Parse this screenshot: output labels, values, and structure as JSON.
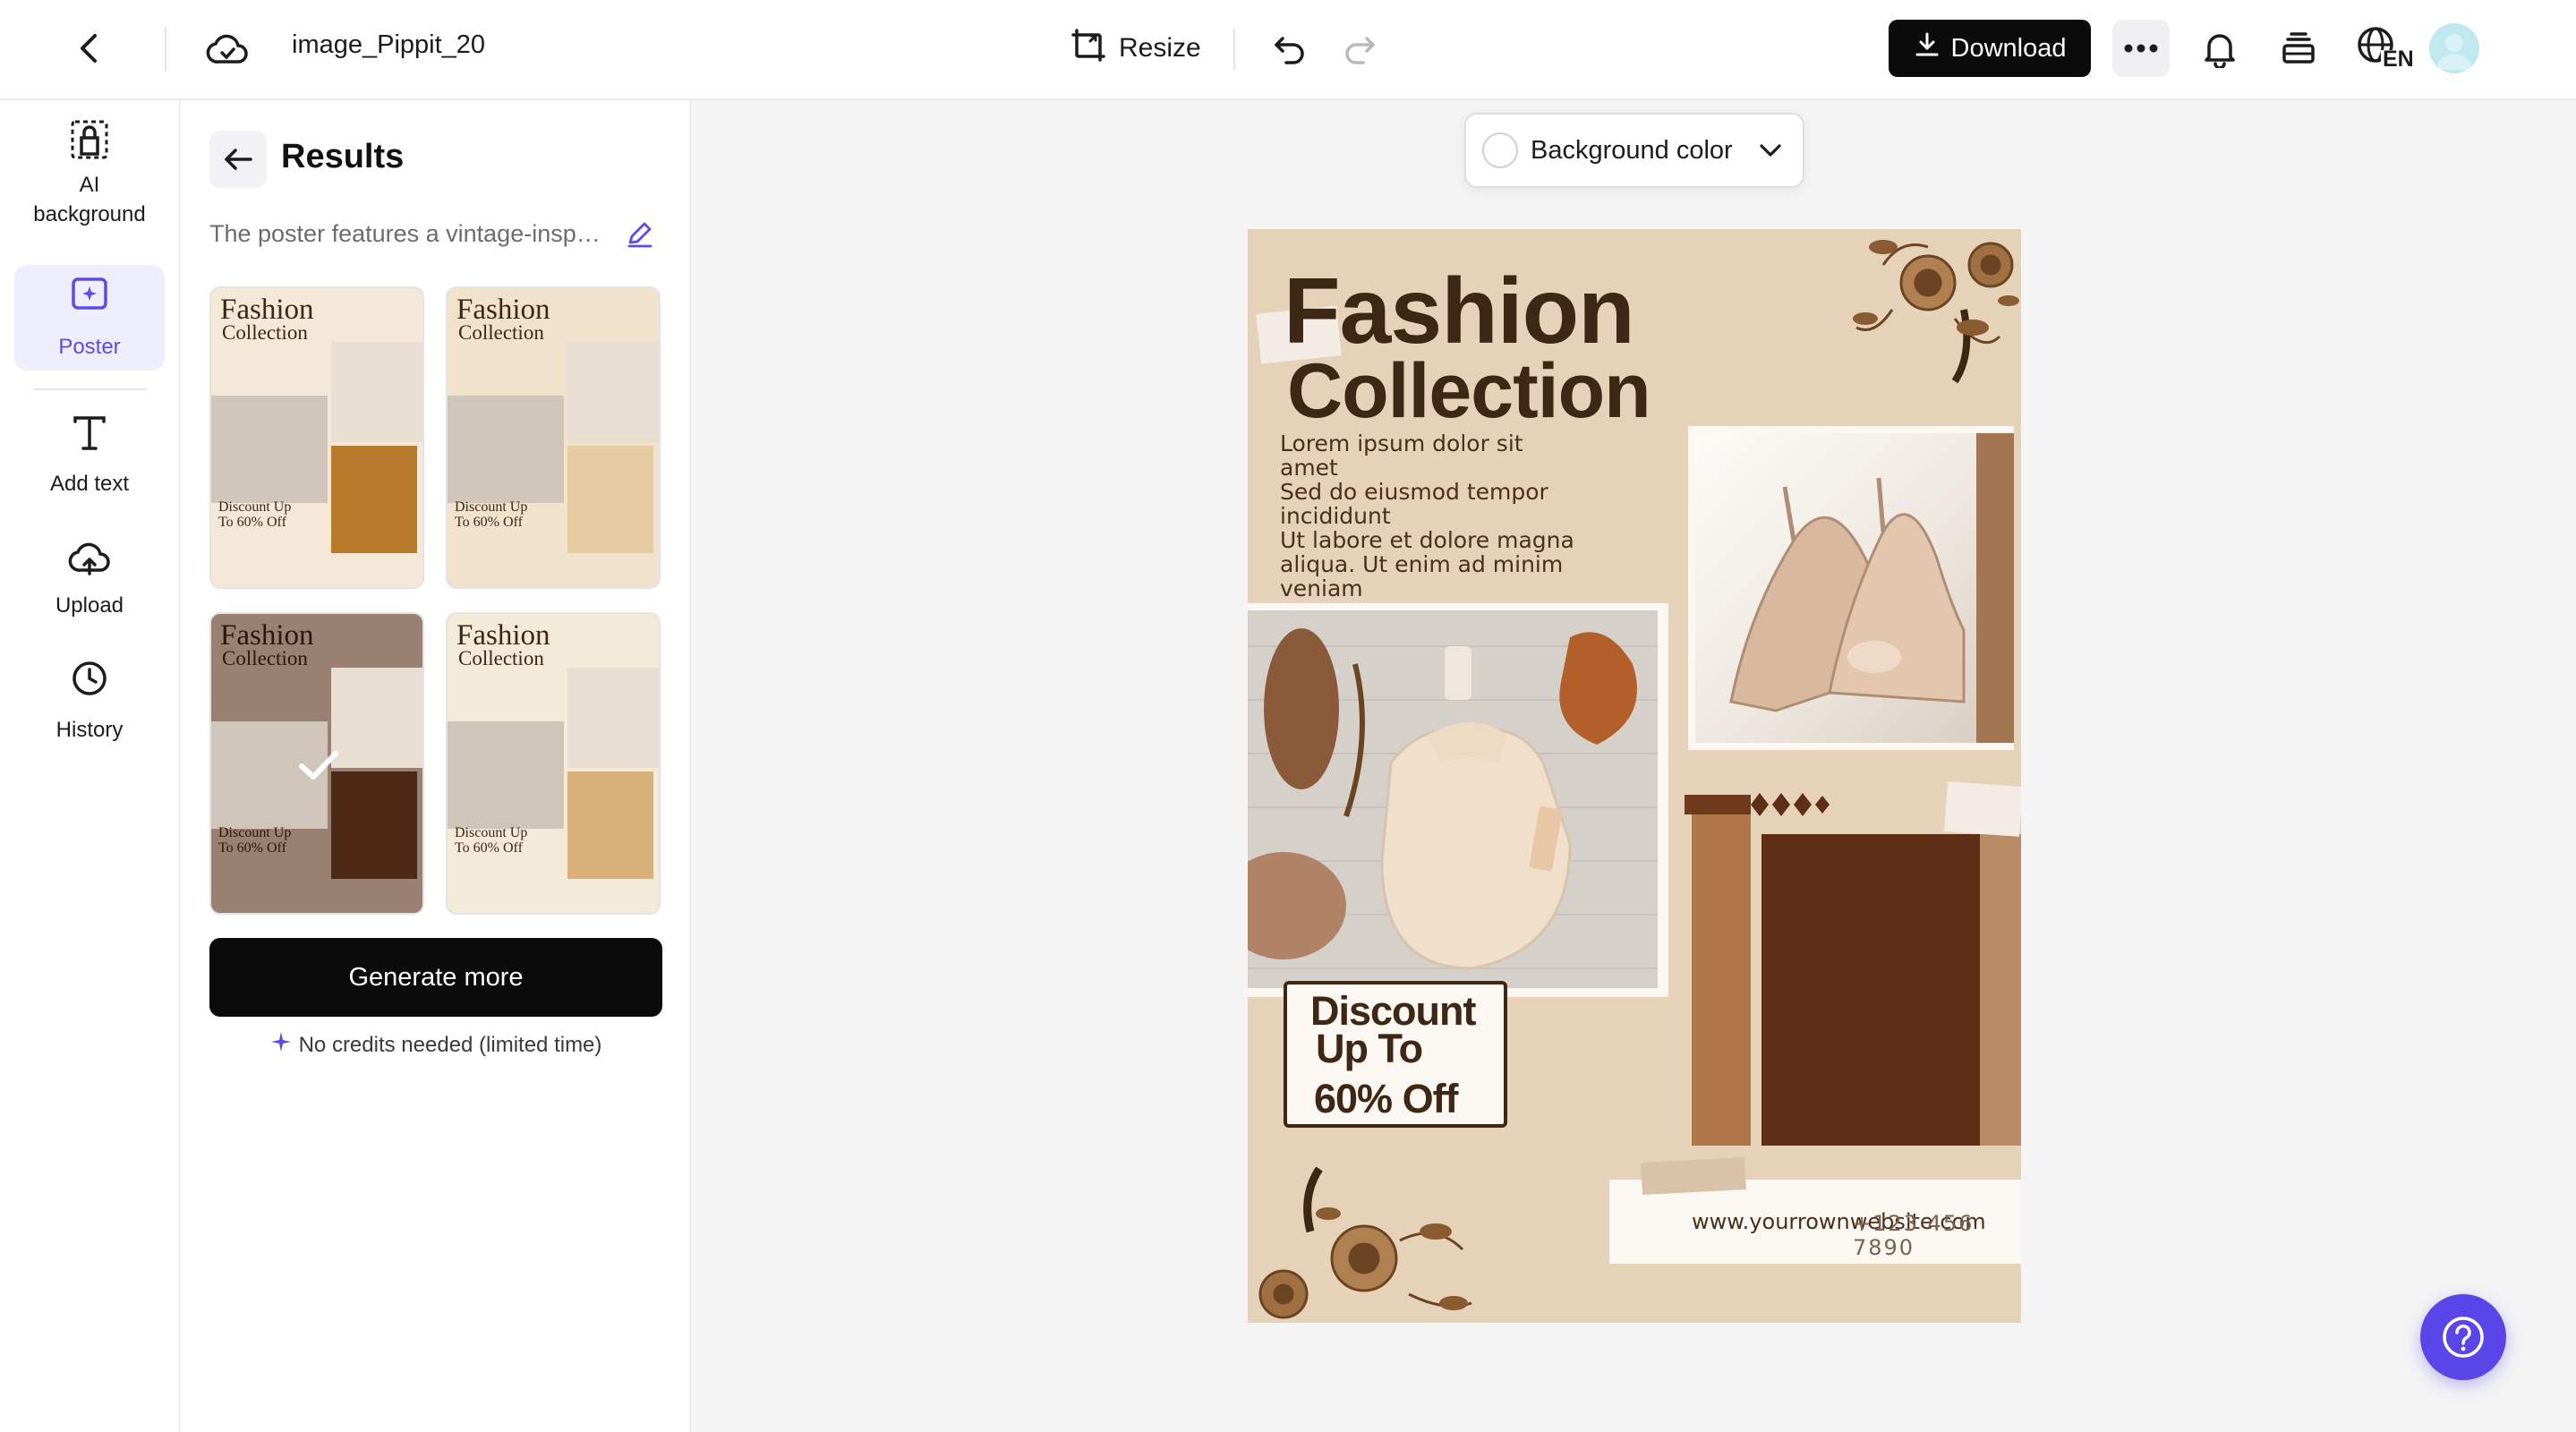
{
  "header": {
    "filename": "image_Pippit_20",
    "resize_label": "Resize",
    "download_label": "Download",
    "language_code": "EN"
  },
  "rail": {
    "items": [
      {
        "label": "AI background",
        "icon": "ai-background-icon"
      },
      {
        "label": "Poster",
        "icon": "poster-icon",
        "active": true
      },
      {
        "label": "Add text",
        "icon": "text-icon"
      },
      {
        "label": "Upload",
        "icon": "upload-cloud-icon"
      },
      {
        "label": "History",
        "icon": "history-clock-icon"
      }
    ]
  },
  "panel": {
    "title": "Results",
    "prompt": "The poster features a vintage-inspired design with a warm beige background and ornate floral corners",
    "thumbnails": [
      {
        "title": "Fashion",
        "subtitle": "Collection",
        "discount": "Discount Up To 60% Off",
        "selected": false
      },
      {
        "title": "Fashion",
        "subtitle": "Collection",
        "discount": "Discount Up To 60% Off",
        "selected": false
      },
      {
        "title": "Fashion",
        "subtitle": "Collection",
        "discount": "Discount Up To 60% Off",
        "selected": true
      },
      {
        "title": "Fashion",
        "subtitle": "Collection",
        "discount": "Discount Up To 60% Off",
        "selected": false
      }
    ],
    "generate_label": "Generate more",
    "credits_note": "No credits needed (limited time)"
  },
  "canvas": {
    "bg_color_label": "Background color",
    "poster": {
      "title_line1": "Fashion",
      "title_line2": "Collection",
      "body": [
        "Lorem ipsum dolor sit",
        "amet",
        "Sed do eiusmod tempor",
        "incididunt",
        "Ut labore et dolore magna",
        "aliqua. Ut enim ad minim",
        "veniam"
      ],
      "discount_line1": "Discount",
      "discount_line2": "Up To",
      "discount_line3": "60% Off",
      "website": "www.yourrownwebsite.com",
      "phone": "+123 456 7890"
    }
  },
  "colors": {
    "accent": "#5b4ce6",
    "poster_bg": "#e6d2b8",
    "poster_brown": "#5e2e17",
    "button_dark": "#0b0b0b"
  }
}
